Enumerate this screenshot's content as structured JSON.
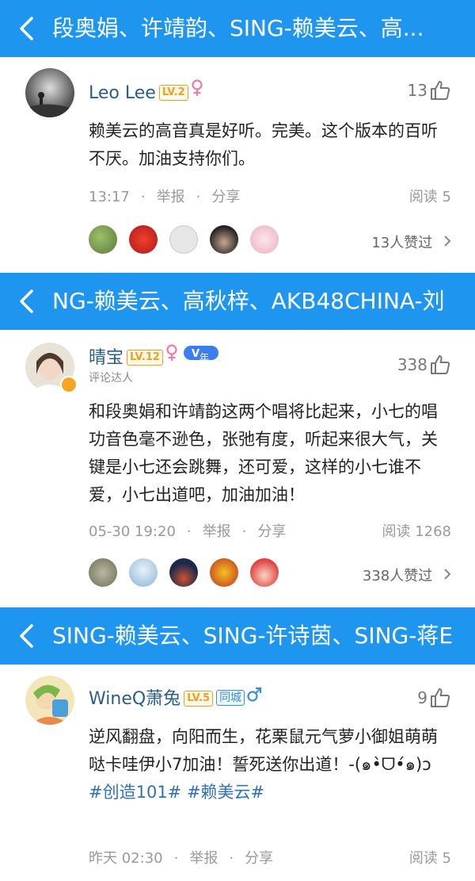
{
  "topics": [
    {
      "title": "段奥娟、许靖韵、SING-赖美云、高..."
    },
    {
      "title": "NG-赖美云、高秋梓、AKB48CHINA-刘"
    },
    {
      "title": "SING-赖美云、SING-许诗茵、SING-蒋E"
    }
  ],
  "comments": [
    {
      "user": "Leo Lee",
      "level": "LV.2",
      "likes": "13",
      "text": "赖美云的高音真是好听。完美。这个版本的百听不厌。加油支持你们。",
      "time": "13:17",
      "report": "举报",
      "share": "分享",
      "reads": "阅读 5",
      "liked_by": "13人赞过"
    },
    {
      "user": "晴宝",
      "level": "LV.12",
      "vip": "年",
      "subtitle": "评论达人",
      "likes": "338",
      "text": "和段奥娟和许靖韵这两个唱将比起来，小七的唱功音色毫不逊色，张弛有度，听起来很大气，关键是小七还会跳舞，还可爱，这样的小七谁不爱，小七出道吧，加油加油！",
      "time": "05-30 19:20",
      "report": "举报",
      "share": "分享",
      "reads": "阅读 1268",
      "liked_by": "338人赞过"
    },
    {
      "user": "WineQ萧兔",
      "level": "LV.5",
      "city": "同城",
      "likes": "9",
      "text": "逆风翻盘，向阳而生，花栗鼠元气萝小御姐萌萌哒卡哇伊小7加油！誓死送你出道！-(๑•̀ㅂ•́)و✧",
      "text_display": "逆风翻盘，向阳而生，花栗鼠元气萝小御姐萌萌哒卡哇伊小7加油！誓死送你出道！-(๑•̀ᗜ•́๑)ɔ",
      "tags": "#创造101# #赖美云#",
      "time": "昨天 02:30",
      "report": "举报",
      "share": "分享",
      "reads": "阅读 5"
    }
  ],
  "colors": {
    "header": "#1e96f0",
    "username": "#2a5d8c",
    "level": "#f0a020"
  }
}
